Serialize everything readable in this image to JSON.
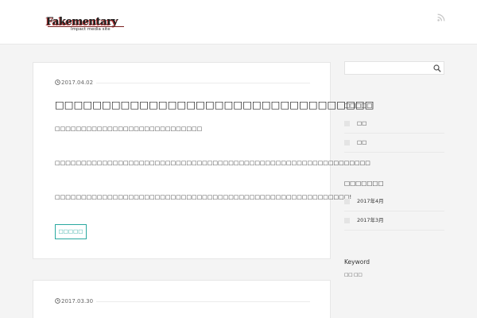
{
  "site": {
    "logo_title": "Fakementary",
    "logo_subtitle": "Impact media site"
  },
  "icons": {
    "rss": "rss-icon",
    "clock": "clock-icon",
    "search": "search-icon"
  },
  "colors": {
    "accent": "#2aa9a0",
    "logo_red": "#b22a2a",
    "background": "#f4f4f4"
  },
  "posts": [
    {
      "date": "2017.04.02",
      "title": "□□□□□□□□□□□□□□□□□□□□□□□□□□□□□□□□□□",
      "paragraphs": [
        "□□□□□□□□□□□□□□□□□□□□□□□□□□□□",
        "□□□□□□□□□□□□□□□□□□□□□□□□□□□□□□□□□□□□□□□□□□□□□□□□□□□□□□□□□□□□",
        "□□□□□□□□□□□□□□□□□□□□□□□□□□□□□□□□□□□□□□□□□□□□□□□□□□□□□□□□!"
      ],
      "more_label": "□□□□□"
    },
    {
      "date": "2017.03.30"
    }
  ],
  "sidebar": {
    "search": {
      "value": "",
      "placeholder": ""
    },
    "categories": {
      "title": "□□□□□",
      "items": [
        "□□",
        "□□"
      ]
    },
    "archives": {
      "title": "□□□□□□□",
      "items": [
        "2017年4月",
        "2017年3月"
      ]
    },
    "keyword": {
      "title": "Keyword",
      "text": "□□ □□"
    }
  }
}
